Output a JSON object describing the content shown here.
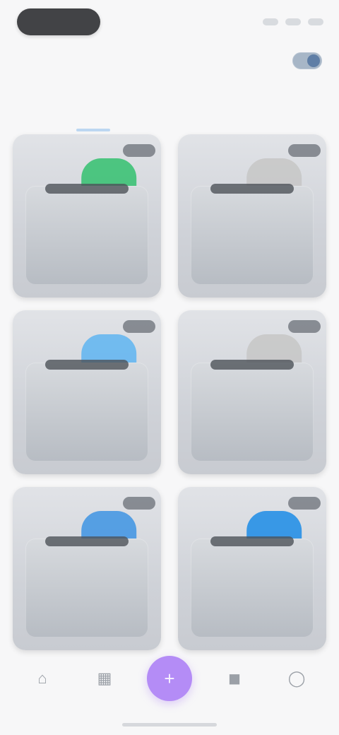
{
  "status": {
    "pill_text": ""
  },
  "header": {
    "title": ""
  },
  "tabs": [
    {
      "label": "",
      "active": true
    },
    {
      "label": "",
      "active": false
    }
  ],
  "grid": {
    "cards": [
      {
        "label": "",
        "accent": "#44c37a",
        "chip": ""
      },
      {
        "label": "",
        "accent": "#c8c8c8",
        "chip": ""
      },
      {
        "label": "",
        "accent": "#6bb8ef",
        "chip": ""
      },
      {
        "label": "",
        "accent": "#c8c8c8",
        "chip": ""
      },
      {
        "label": "",
        "accent": "#4e9be3",
        "chip": ""
      },
      {
        "label": "",
        "accent": "#2f93e6",
        "chip": ""
      }
    ]
  },
  "bottom_nav": {
    "items": [
      {
        "icon": "home-icon"
      },
      {
        "icon": "grid-icon"
      },
      {
        "icon": "plus-icon"
      },
      {
        "icon": "bag-icon"
      },
      {
        "icon": "profile-icon"
      }
    ],
    "center_accent": "#b48cf6"
  }
}
